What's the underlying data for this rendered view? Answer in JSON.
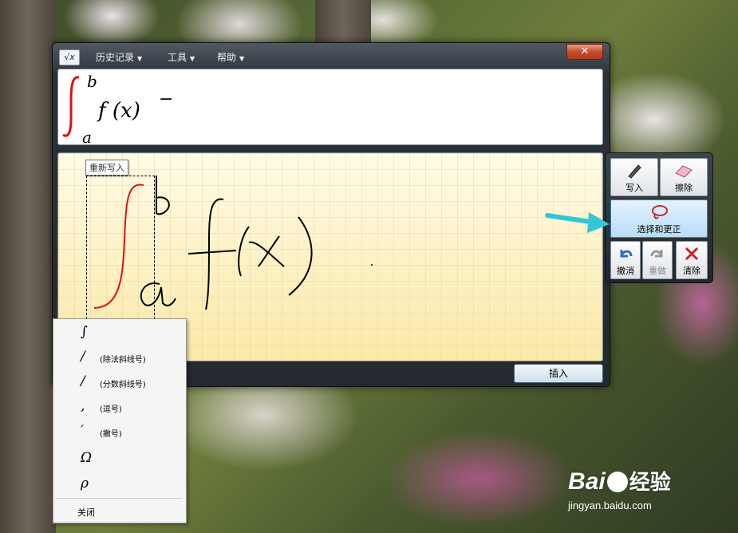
{
  "window": {
    "menus": [
      {
        "label": "历史记录"
      },
      {
        "label": "工具"
      },
      {
        "label": "帮助"
      }
    ],
    "close_label": "✕",
    "app_icon_glyph": "√x"
  },
  "preview": {
    "upper_limit": "b",
    "lower_limit": "a",
    "body": "f (x)",
    "trailing": "−"
  },
  "writing_area": {
    "tooltip": "重新写入"
  },
  "insert_button": "插入",
  "toolbox": {
    "write": "写入",
    "erase": "擦除",
    "select_correct": "选择和更正",
    "undo": "撤消",
    "redo": "重做",
    "clear": "清除"
  },
  "context_menu": {
    "items": [
      {
        "symbol": "∫",
        "desc": ""
      },
      {
        "symbol": "/",
        "desc": "(除法斜线号)"
      },
      {
        "symbol": "/",
        "desc": "(分数斜线号)"
      },
      {
        "symbol": ",",
        "desc": "(逗号)"
      },
      {
        "symbol": "′",
        "desc": "(撇号)"
      },
      {
        "symbol": "Ω",
        "desc": ""
      },
      {
        "symbol": "ρ",
        "desc": ""
      }
    ],
    "close": "关闭"
  },
  "watermark": {
    "brand": "Bai",
    "brand_suffix": "经验",
    "site": "jingyan.baidu.com"
  },
  "colors": {
    "ink_red": "#e01010",
    "ink_black": "#000000",
    "arrow": "#35c6d6"
  }
}
